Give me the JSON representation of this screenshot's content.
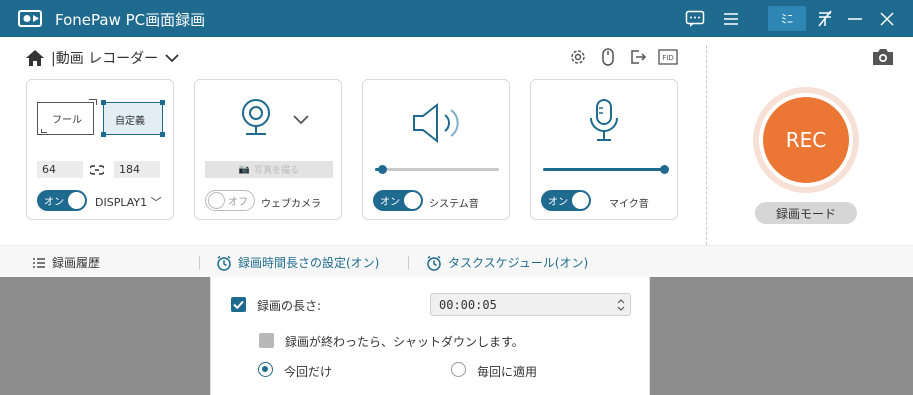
{
  "titlebar": {
    "title": "FonePaw PC画面録画",
    "mini_label": "ﾐﾆ"
  },
  "mode": {
    "label": "|動画 レコーダー"
  },
  "screen_card": {
    "full_label": "フール",
    "custom_label": "自定義",
    "width": "64",
    "height": "184",
    "toggle": "オン",
    "display": "DISPLAY1"
  },
  "webcam_card": {
    "photo_button": "写真を撮る",
    "toggle": "オフ",
    "label": "ウェブカメラ"
  },
  "system_card": {
    "toggle": "オン",
    "label": "システム音",
    "volume": 0.06
  },
  "mic_card": {
    "toggle": "オン",
    "label": "マイク音",
    "volume": 0.98
  },
  "rec": {
    "button": "REC",
    "mode_button": "録画モード"
  },
  "bottom_bar": {
    "history": "録画履歴",
    "duration": "録画時間長さの設定(オン)",
    "schedule": "タスクスケジュール(オン)"
  },
  "popup": {
    "length_label": "録画の長さ:",
    "length_value": "00:00:05",
    "shutdown_label": "録画が終わったら、シャットダウンします。",
    "once_label": "今回だけ",
    "every_label": "毎回に適用"
  },
  "colors": {
    "accent": "#1f6b8f",
    "rec": "#ec7735"
  }
}
